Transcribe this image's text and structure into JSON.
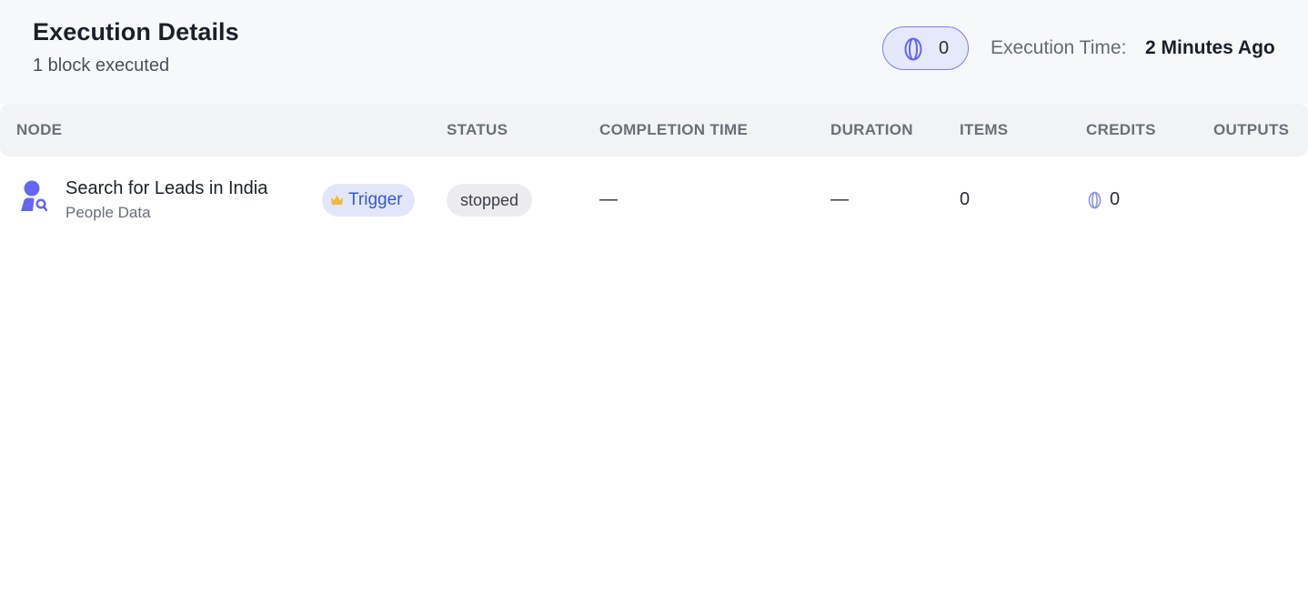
{
  "header": {
    "title": "Execution Details",
    "subtitle": "1 block executed",
    "credits_value": "0",
    "execution_time_label": "Execution Time:",
    "execution_time_value": "2 Minutes Ago"
  },
  "table": {
    "columns": [
      "NODE",
      "STATUS",
      "COMPLETION TIME",
      "DURATION",
      "ITEMS",
      "CREDITS",
      "OUTPUTS"
    ],
    "rows": [
      {
        "icon": "person-search-icon",
        "title": "Search for Leads in India",
        "subtitle": "People Data",
        "badge": "Trigger",
        "status": "stopped",
        "completion_time": "—",
        "duration": "—",
        "items": "0",
        "credits": "0",
        "outputs": ""
      }
    ]
  },
  "colors": {
    "accent": "#6366f1",
    "pill_bg": "#e6e8fb",
    "trigger_text": "#2f5bd9",
    "crown": "#f0b93a"
  }
}
